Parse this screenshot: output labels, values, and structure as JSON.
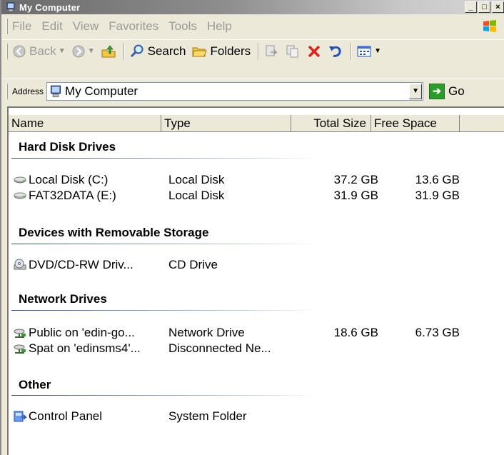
{
  "window": {
    "title": "My Computer"
  },
  "caption_buttons": [
    "_",
    "□",
    "×"
  ],
  "menu": [
    "File",
    "Edit",
    "View",
    "Favorites",
    "Tools",
    "Help"
  ],
  "toolbar": {
    "back": "Back",
    "search": "Search",
    "folders": "Folders"
  },
  "address": {
    "label": "Address",
    "value": "My Computer",
    "go": "Go"
  },
  "columns": [
    "Name",
    "Type",
    "Total Size",
    "Free Space"
  ],
  "groups": [
    {
      "title": "Hard Disk Drives",
      "items": [
        {
          "name": "Local Disk (C:)",
          "type": "Local Disk",
          "total": "37.2 GB",
          "free": "13.6 GB",
          "icon": "hard-disk-icon"
        },
        {
          "name": "FAT32DATA (E:)",
          "type": "Local Disk",
          "total": "31.9 GB",
          "free": "31.9 GB",
          "icon": "hard-disk-icon"
        }
      ]
    },
    {
      "title": "Devices with Removable Storage",
      "items": [
        {
          "name": "DVD/CD-RW Driv...",
          "type": "CD Drive",
          "total": "",
          "free": "",
          "icon": "cd-drive-icon"
        }
      ]
    },
    {
      "title": "Network Drives",
      "items": [
        {
          "name": "Public on 'edin-go...",
          "type": "Network Drive",
          "total": "18.6 GB",
          "free": "6.73 GB",
          "icon": "network-drive-icon"
        },
        {
          "name": "Spat on 'edinsms4'...",
          "type": "Disconnected Ne...",
          "total": "",
          "free": "",
          "icon": "network-drive-icon"
        }
      ]
    },
    {
      "title": "Other",
      "items": [
        {
          "name": "Control Panel",
          "type": "System Folder",
          "total": "",
          "free": "",
          "icon": "control-panel-icon"
        }
      ]
    }
  ]
}
